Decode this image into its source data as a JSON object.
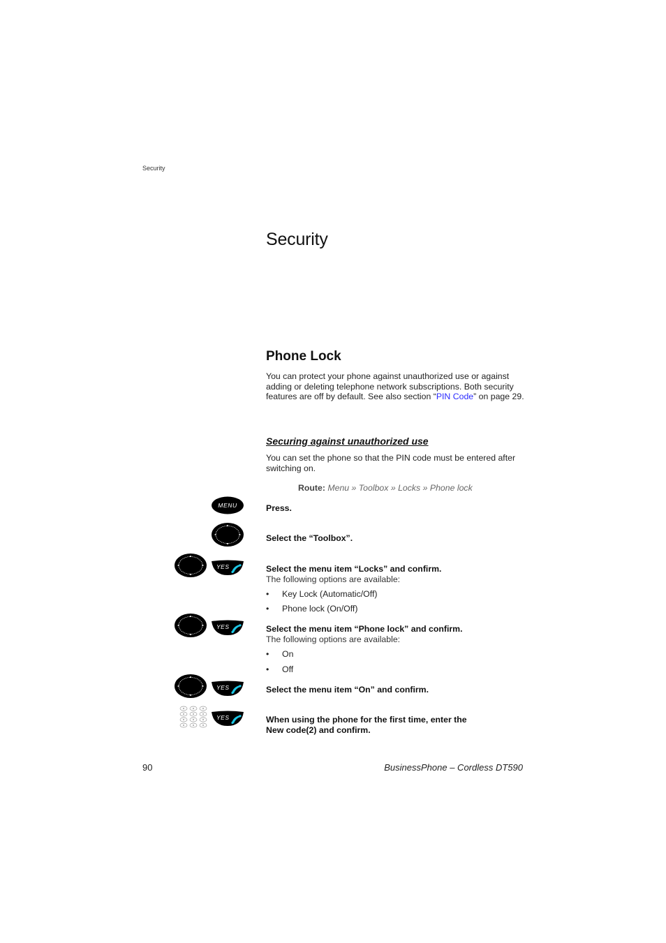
{
  "running_header": "Security",
  "page_title": "Security",
  "section": {
    "title": "Phone Lock",
    "intro_before_link": "You can protect your phone against unauthorized use or against adding or deleting telephone network subscriptions. Both security features are off by default. See also section “",
    "intro_link": "PIN Code",
    "intro_after_link": "” on page 29."
  },
  "subsection": {
    "title": "Securing against unauthorized use",
    "intro": "You can set the phone so that the PIN code must be entered after switching on.",
    "route_label": "Route:",
    "route_path": "Menu » Toolbox » Locks » Phone lock"
  },
  "keys": {
    "menu_label": "MENU",
    "yes_label": "YES"
  },
  "steps": [
    {
      "icons": [
        "menu-key"
      ],
      "instruction": "Press.",
      "sub": "",
      "options": []
    },
    {
      "icons": [
        "navigation-key"
      ],
      "instruction": "Select the “Toolbox”.",
      "sub": "",
      "options": []
    },
    {
      "icons": [
        "navigation-key",
        "yes-key"
      ],
      "instruction": "Select the menu item “Locks” and confirm.",
      "sub": "The following options are available:",
      "options": [
        "Key Lock (Automatic/Off)",
        "Phone lock (On/Off)"
      ]
    },
    {
      "icons": [
        "navigation-key",
        "yes-key"
      ],
      "instruction": "Select the menu item “Phone lock” and confirm.",
      "sub": "The following options are available:",
      "options": [
        "On",
        "Off"
      ]
    },
    {
      "icons": [
        "navigation-key",
        "yes-key"
      ],
      "instruction": "Select the menu item “On” and confirm.",
      "sub": "",
      "options": []
    },
    {
      "icons": [
        "keypad",
        "yes-key"
      ],
      "instruction_line1": "When using the phone for the first time, enter the",
      "instruction_line2": "New code(2) and confirm.",
      "sub": "",
      "options": []
    }
  ],
  "bullet_char": "•",
  "footer": {
    "page_number": "90",
    "document_title": "BusinessPhone – Cordless DT590"
  },
  "colors": {
    "link": "#2a2aff",
    "key_body": "#000000",
    "call_icon": "#1ec8e6"
  }
}
